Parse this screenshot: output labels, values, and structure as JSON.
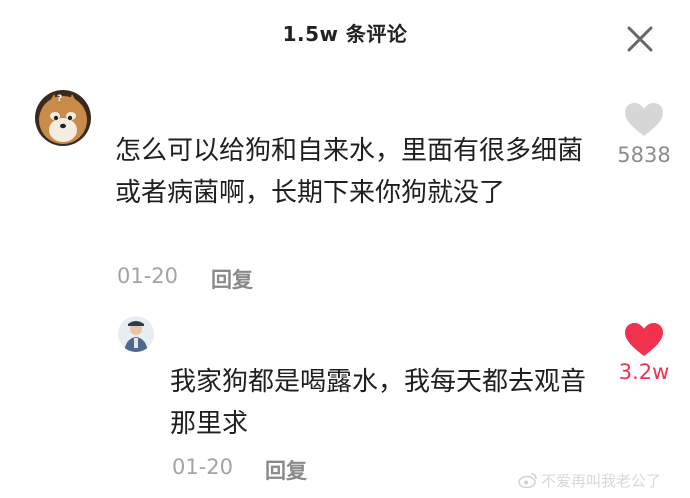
{
  "header": {
    "title": "1.5w 条评论",
    "close_icon": "close-icon"
  },
  "comments": [
    {
      "avatar": "shiba-dog-avatar",
      "text": "怎么可以给狗和自来水，里面有很多细菌或者病菌啊，长期下来你狗就没了",
      "time": "01-20",
      "reply_label": "回复",
      "like_count": "5838",
      "liked": false,
      "like_color": "#d6d6d6"
    },
    {
      "avatar": "person-avatar",
      "text": "我家狗都是喝露水，我每天都去观音那里求",
      "time": "01-20",
      "reply_label": "回复",
      "like_count": "3.2w",
      "liked": true,
      "like_color": "#f0324f"
    }
  ],
  "watermark": {
    "text": "不爱再叫我老公了",
    "logo": "weibo-logo"
  }
}
